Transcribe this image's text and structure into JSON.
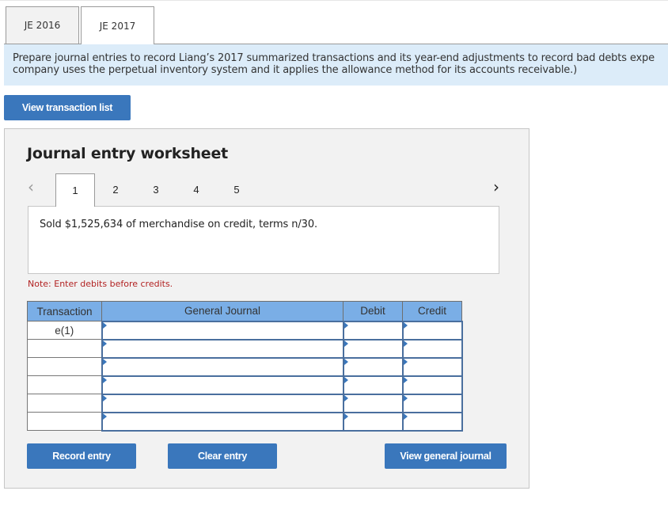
{
  "tabs": [
    {
      "label": "JE 2016",
      "active": false
    },
    {
      "label": "JE 2017",
      "active": true
    }
  ],
  "instructions": {
    "line1": "Prepare journal entries to record Liang’s 2017 summarized transactions and its year-end adjustments to record bad debts expe",
    "line2": "company uses the perpetual inventory system and it applies the allowance method for its accounts receivable.)"
  },
  "buttons": {
    "view_transaction_list": "View transaction list",
    "record_entry": "Record entry",
    "clear_entry": "Clear entry",
    "view_general_journal": "View general journal"
  },
  "worksheet": {
    "title": "Journal entry worksheet",
    "nav_prev_icon": "‹",
    "nav_next_icon": "›",
    "steps": [
      "1",
      "2",
      "3",
      "4",
      "5"
    ],
    "active_step": "1",
    "description": "Sold $1,525,634 of merchandise on credit, terms n/30.",
    "note": "Note: Enter debits before credits."
  },
  "journal_table": {
    "headers": {
      "transaction": "Transaction",
      "general_journal": "General Journal",
      "debit": "Debit",
      "credit": "Credit"
    },
    "rows": [
      {
        "transaction": "e(1)",
        "account": "",
        "debit": "",
        "credit": ""
      },
      {
        "transaction": "",
        "account": "",
        "debit": "",
        "credit": ""
      },
      {
        "transaction": "",
        "account": "",
        "debit": "",
        "credit": ""
      },
      {
        "transaction": "",
        "account": "",
        "debit": "",
        "credit": ""
      },
      {
        "transaction": "",
        "account": "",
        "debit": "",
        "credit": ""
      },
      {
        "transaction": "",
        "account": "",
        "debit": "",
        "credit": ""
      }
    ]
  },
  "colors": {
    "primary_button": "#3a77bc",
    "instruction_bg": "#dcecf9",
    "table_header_bg": "#7aaee6",
    "note_text": "#b22222",
    "worksheet_bg": "#f2f2f2"
  }
}
